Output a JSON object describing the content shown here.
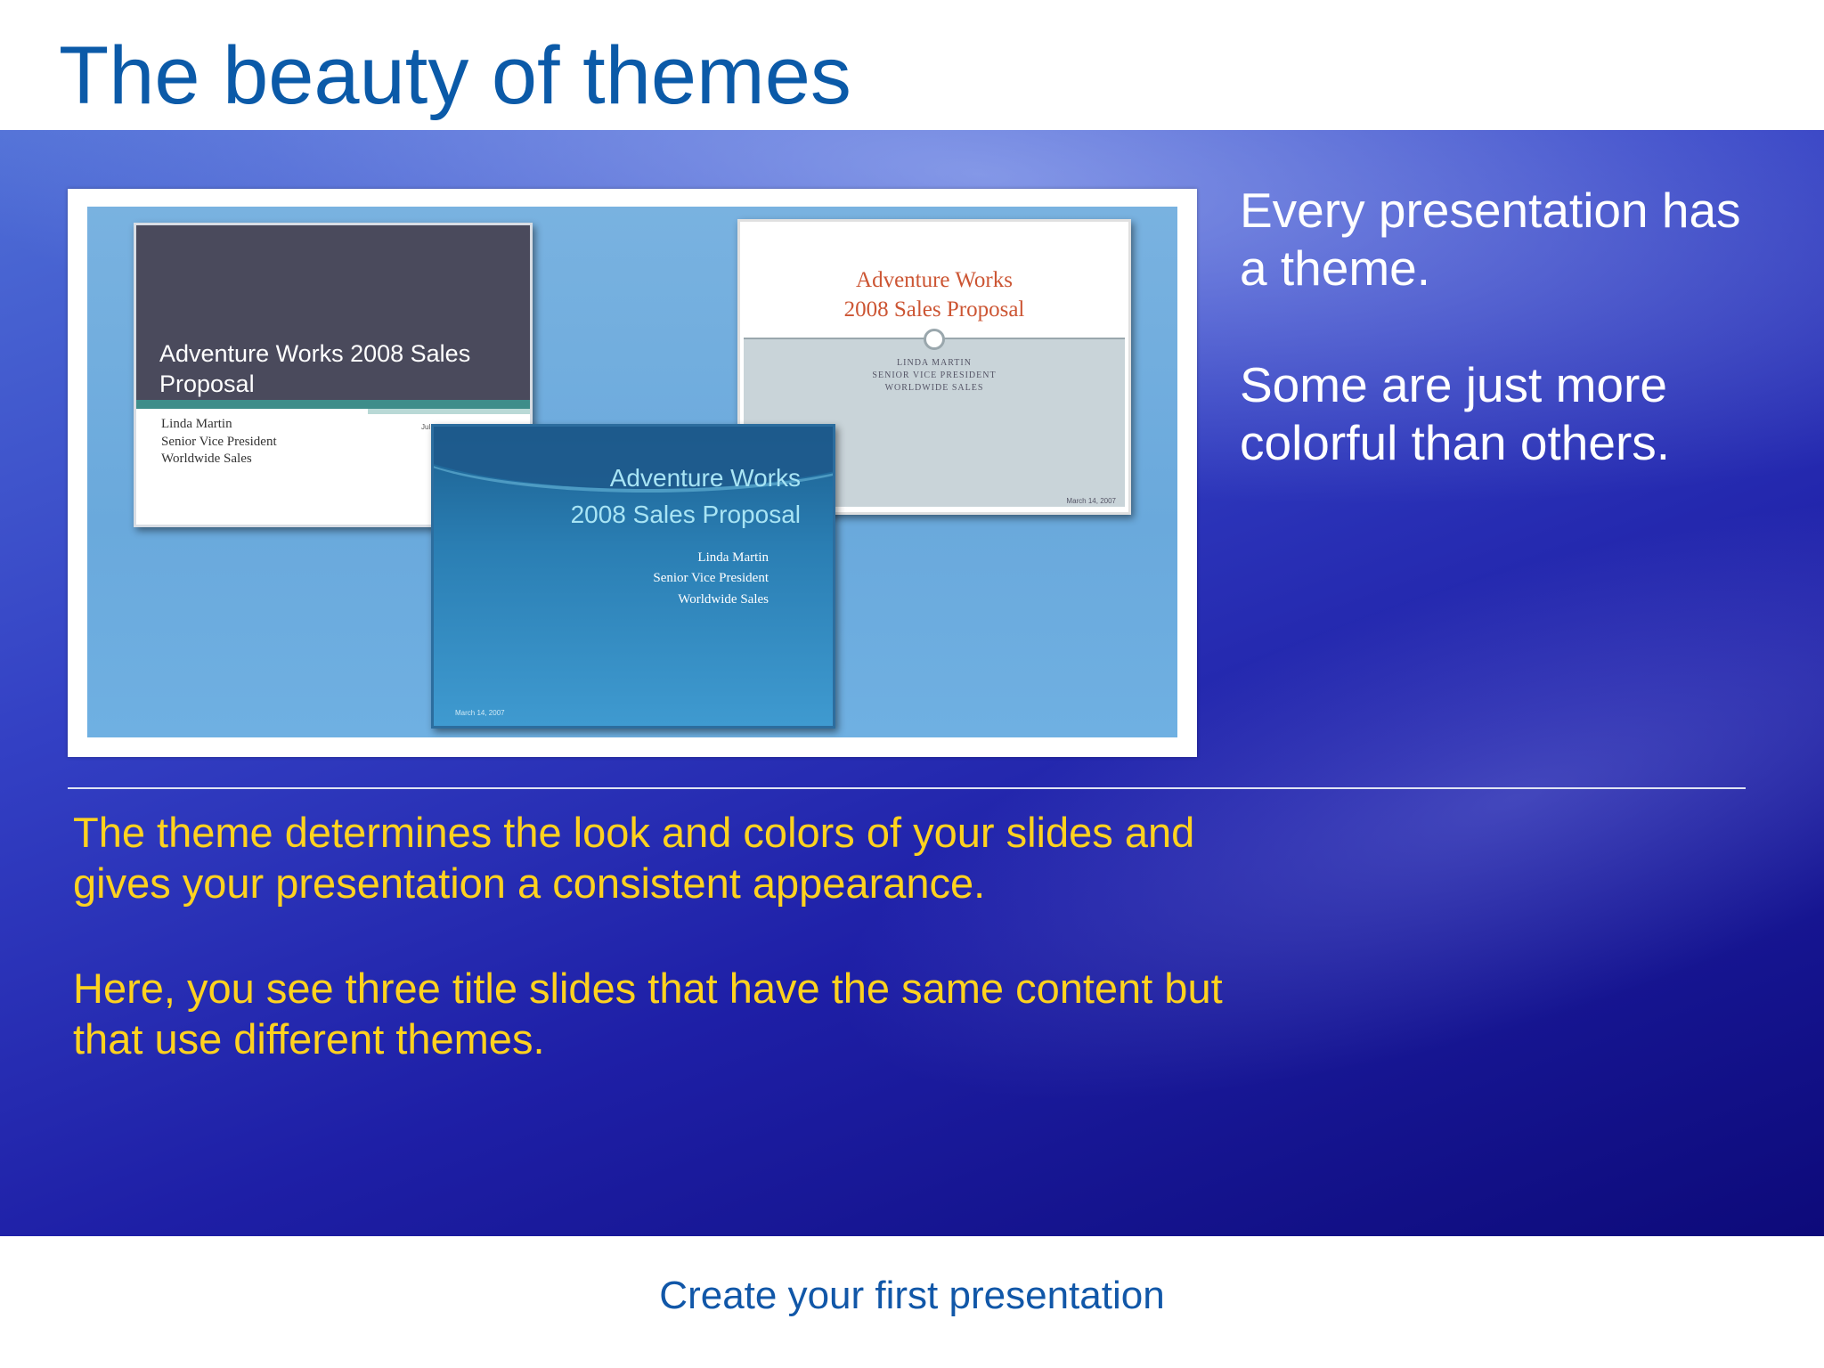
{
  "slide": {
    "title": "The beauty of themes",
    "side_text": [
      "Every presentation has a theme.",
      "Some are just more colorful than others."
    ],
    "body_text": [
      "The theme determines the look and colors of your slides and gives your presentation a consistent appearance.",
      "Here, you see three title slides that have the same content but that use different themes."
    ],
    "footer": "Create your first presentation"
  },
  "thumbnails": {
    "dark": {
      "title": "Adventure Works 2008 Sales Proposal",
      "subtitle": "Linda Martin\nSenior Vice President\nWorldwide Sales",
      "date": "Jul 4, 2007"
    },
    "light": {
      "title": "Adventure Works\n2008 Sales Proposal",
      "subtitle": "LINDA MARTIN\nSENIOR VICE PRESIDENT\nWORLDWIDE SALES",
      "date": "March 14, 2007"
    },
    "blue": {
      "title": "Adventure Works\n2008 Sales Proposal",
      "subtitle": "Linda Martin\nSenior Vice President\nWorldwide Sales",
      "date": "March 14, 2007"
    }
  },
  "colors": {
    "title": "#0b5aa8",
    "body_text": "#ffd21f",
    "side_text": "#ffffff",
    "footer": "#1157a8"
  }
}
